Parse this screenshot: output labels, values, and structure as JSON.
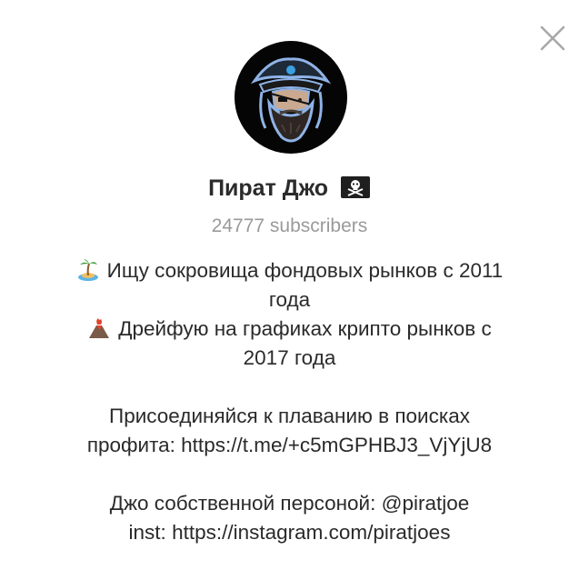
{
  "channel": {
    "name": "Пират Джо",
    "flag_icon": "pirate-flag-icon",
    "subscribers": "24777 subscribers"
  },
  "bio": {
    "line1": "Ищу сокровища фондовых рынков с 2011",
    "line1b": "года",
    "line1_icon": "desert-island-icon",
    "line2": "Дрейфую на графиках крипто рынков с",
    "line2b": "2017 года",
    "line2_icon": "volcano-icon",
    "line3": "Присоединяйся к плаванию в поисках",
    "line3b": "профита: https://t.me/+c5mGPHBJ3_VjYjU8",
    "line4": "Джо собственной персоной: @piratjoe",
    "line5": "inst: https://instagram.com/piratjoes"
  },
  "close_icon": "close-icon",
  "avatar_icon": "pirate-avatar-icon"
}
